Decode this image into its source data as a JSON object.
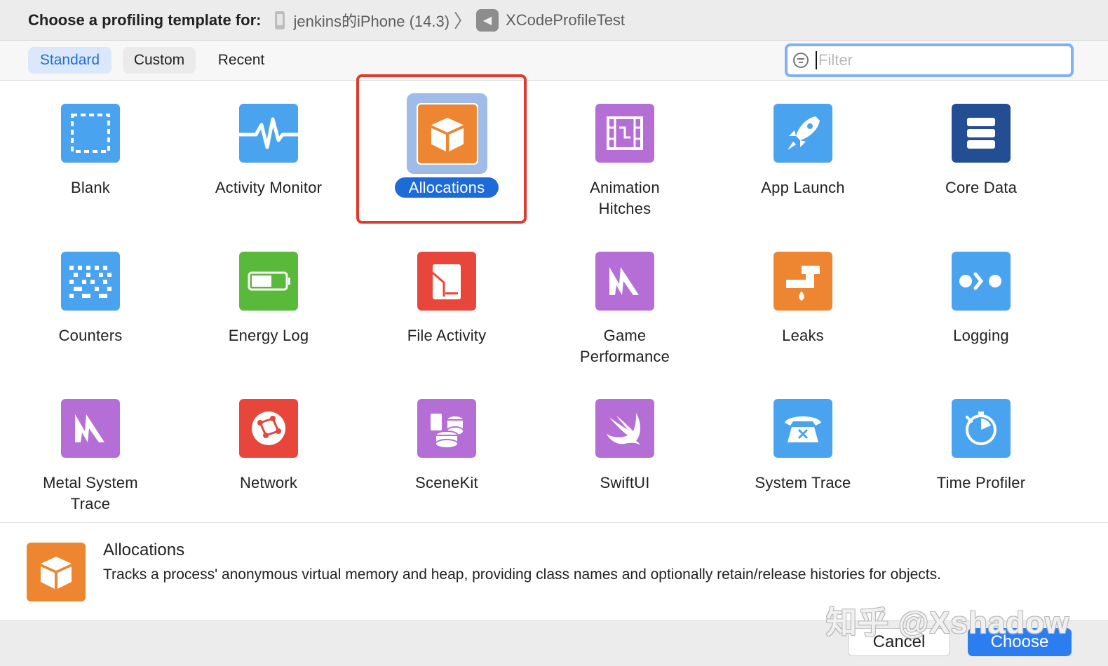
{
  "header": {
    "prompt": "Choose a profiling template for:",
    "device": "jenkins的iPhone (14.3)",
    "separator": "〉",
    "app": "XCodeProfileTest"
  },
  "tabs": [
    {
      "label": "Standard",
      "selected": true
    },
    {
      "label": "Custom",
      "selected": false
    },
    {
      "label": "Recent",
      "selected": false
    }
  ],
  "filter": {
    "placeholder": "Filter",
    "value": ""
  },
  "templates": [
    {
      "name": "Blank",
      "icon": "blank-icon",
      "color": "#4aa3ef"
    },
    {
      "name": "Activity Monitor",
      "icon": "activity-monitor-icon",
      "color": "#4aa3ef"
    },
    {
      "name": "Allocations",
      "icon": "allocations-icon",
      "color": "#ee8530",
      "selected": true
    },
    {
      "name": "Animation Hitches",
      "icon": "film-icon",
      "color": "#b56ed6"
    },
    {
      "name": "App Launch",
      "icon": "rocket-icon",
      "color": "#4aa3ef"
    },
    {
      "name": "Core Data",
      "icon": "database-icon",
      "color": "#234e94"
    },
    {
      "name": "Counters",
      "icon": "counters-icon",
      "color": "#4aa3ef"
    },
    {
      "name": "Energy Log",
      "icon": "battery-icon",
      "color": "#59b93a"
    },
    {
      "name": "File Activity",
      "icon": "file-activity-icon",
      "color": "#e8463b"
    },
    {
      "name": "Game Performance",
      "icon": "metal-icon",
      "color": "#b56ed6"
    },
    {
      "name": "Leaks",
      "icon": "faucet-icon",
      "color": "#ee8530"
    },
    {
      "name": "Logging",
      "icon": "logging-icon",
      "color": "#4aa3ef"
    },
    {
      "name": "Metal System Trace",
      "icon": "metal-icon",
      "color": "#b56ed6"
    },
    {
      "name": "Network",
      "icon": "network-icon",
      "color": "#e8463b"
    },
    {
      "name": "SceneKit",
      "icon": "scenekit-icon",
      "color": "#b56ed6"
    },
    {
      "name": "SwiftUI",
      "icon": "swift-icon",
      "color": "#b56ed6"
    },
    {
      "name": "System Trace",
      "icon": "telephone-icon",
      "color": "#4aa3ef"
    },
    {
      "name": "Time Profiler",
      "icon": "stopwatch-icon",
      "color": "#4aa3ef"
    }
  ],
  "detail": {
    "title": "Allocations",
    "description": "Tracks a process' anonymous virtual memory and heap, providing class names and optionally retain/release histories for objects.",
    "icon": "allocations-icon"
  },
  "buttons": {
    "cancel": "Cancel",
    "choose": "Choose"
  },
  "watermark": "知乎 @Xshadow"
}
